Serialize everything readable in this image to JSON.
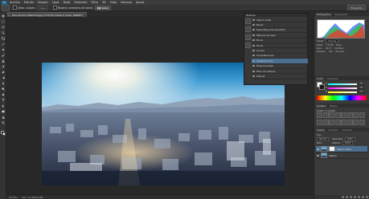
{
  "menubar": {
    "logo": "Ps",
    "items": [
      "Archivo",
      "Edición",
      "Imagen",
      "Capa",
      "Texto",
      "Selección",
      "Filtro",
      "3D",
      "Vista",
      "Ventana",
      "Ayuda"
    ]
  },
  "options": {
    "auto_select_label": "Selec. autom.:",
    "auto_select_target": "Capa",
    "transform_label": "Mostrar controles de transf.",
    "workspace": "Fotografía"
  },
  "document": {
    "tab_title": "Panoramica Valladolid.jpg al 33,3% (Capa 0 copia, RGB/8*)",
    "close": "×"
  },
  "status": {
    "zoom": "33,33%",
    "doc_info": "Doc: 11,4M/22,8M"
  },
  "float_panel": {
    "tab": "Historia",
    "rows": [
      {
        "label": "Capa 0 copia"
      },
      {
        "label": "Mover"
      },
      {
        "label": "Desenfoque de superficie"
      },
      {
        "label": "Máscara de capa"
      },
      {
        "label": "Pincel"
      },
      {
        "label": "Pincel"
      },
      {
        "label": "Curvas"
      },
      {
        "label": "Tono/saturación"
      },
      {
        "label": "Ajuste de color"
      },
      {
        "label": "Brillo/contraste"
      },
      {
        "label": "Filtro de enfoque"
      },
      {
        "label": "Enfocar"
      }
    ],
    "selected_index": 8
  },
  "histogram": {
    "tabs": [
      "Histograma",
      "Navegador"
    ],
    "source_label": "Canal:",
    "source_value": "Colores",
    "stats": [
      [
        "Media:",
        "113,28",
        "Nivel:",
        ""
      ],
      [
        "Desv.:",
        "64,71",
        "Cantidad:",
        ""
      ],
      [
        "Mediana:",
        "104",
        "Percentil:",
        ""
      ]
    ],
    "colors": {
      "red": "#ff2a2a",
      "green": "#2acc2a",
      "blue": "#2a5cff",
      "gray": "#a0a0a0"
    }
  },
  "color_panel": {
    "tabs": [
      "Color",
      "Muestras"
    ],
    "channels": [
      {
        "ch": "R",
        "value": "255"
      },
      {
        "ch": "G",
        "value": "255"
      },
      {
        "ch": "B",
        "value": "255"
      }
    ]
  },
  "adjustments": {
    "tabs": [
      "Ajustes",
      "Estilos"
    ],
    "title": "Añadir un ajuste"
  },
  "layers": {
    "tabs": [
      "Capas",
      "Canales",
      "Trazados"
    ],
    "kind_label": "Tipo",
    "blend_mode": "Normal",
    "opacity_label": "Opacidad:",
    "opacity_value": "100%",
    "lock_label": "Bloq.:",
    "fill_label": "Relleno:",
    "fill_value": "100%",
    "items": [
      {
        "name": "Capa 0 copia",
        "active": true
      },
      {
        "name": "Capa 0",
        "active": false
      }
    ]
  }
}
